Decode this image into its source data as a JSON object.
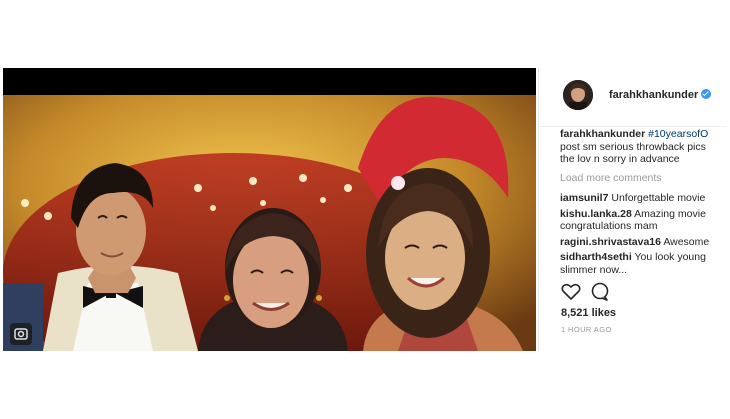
{
  "post": {
    "username": "farahkhankunder",
    "caption_hashtag": "#10yearsofO",
    "caption_lines": [
      "post sm serious throwback pics",
      "the lov n sorry in advance"
    ],
    "load_more": "Load more comments",
    "comments": [
      {
        "user": "iamsunil7",
        "text": " Unforgettable movie"
      },
      {
        "user": "kishu.lanka.28",
        "text": " Amazing movie",
        "cont": "congratulations mam"
      },
      {
        "user": "ragini.shrivastava16",
        "text": " Awesome"
      },
      {
        "user": "sidharth4sethi",
        "text": " You look young",
        "cont": "slimmer now..."
      }
    ],
    "likes": "8,521 likes",
    "time": "1 HOUR AGO"
  },
  "icons": {
    "like": "heart-icon",
    "comment": "comment-icon",
    "badge": "camera-icon"
  },
  "colors": {
    "username": "#262626",
    "hashtag": "#003569",
    "muted": "#999999",
    "verified": "#3897f0"
  }
}
